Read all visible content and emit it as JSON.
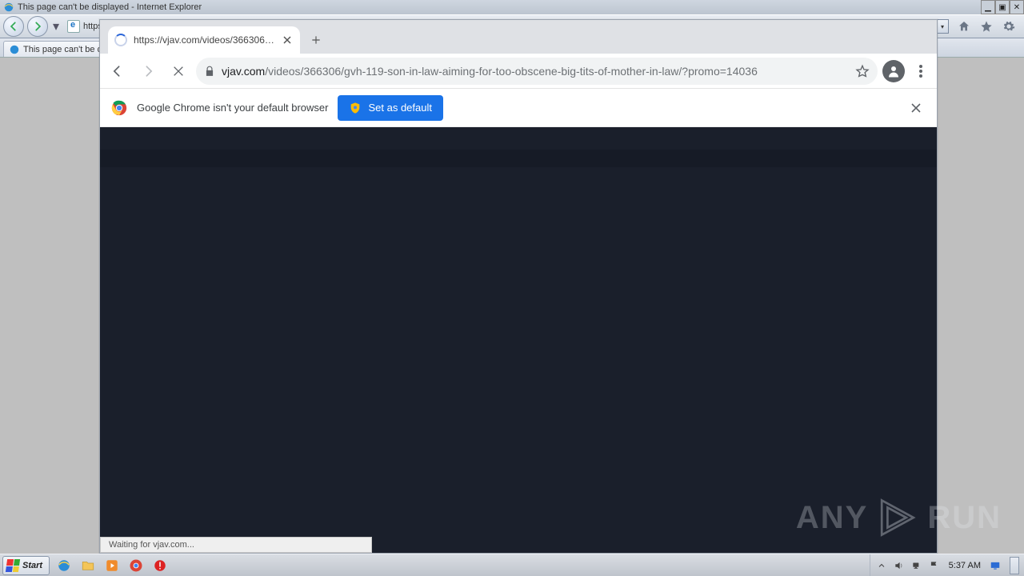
{
  "ie": {
    "title": "This page can't be displayed - Internet Explorer",
    "tab_label": "This page can't be d",
    "url_hint": "https"
  },
  "chrome": {
    "tab_title": "https://vjav.com/videos/366306/gv",
    "url_host": "vjav.com",
    "url_path": "/videos/366306/gvh-119-son-in-law-aiming-for-too-obscene-big-tits-of-mother-in-law/?promo=14036",
    "infobar_text": "Google Chrome isn't your default browser",
    "set_default_label": "Set as default",
    "status_text": "Waiting for vjav.com..."
  },
  "watermark": {
    "left": "ANY",
    "right": "RUN"
  },
  "taskbar": {
    "start_label": "Start",
    "clock": "5:37 AM"
  }
}
